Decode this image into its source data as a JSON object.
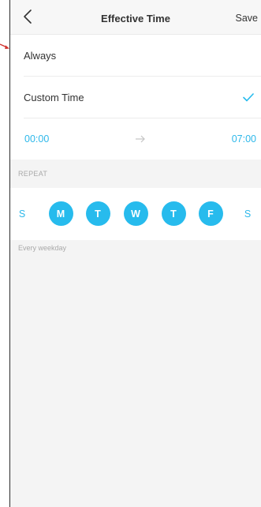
{
  "header": {
    "title": "Effective Time",
    "save_label": "Save"
  },
  "options": {
    "always_label": "Always",
    "custom_label": "Custom Time"
  },
  "time_range": {
    "start": "00:00",
    "end": "07:00"
  },
  "repeat": {
    "section_label": "REPEAT",
    "days": [
      {
        "label": "S",
        "selected": false
      },
      {
        "label": "M",
        "selected": true
      },
      {
        "label": "T",
        "selected": true
      },
      {
        "label": "W",
        "selected": true
      },
      {
        "label": "T",
        "selected": true
      },
      {
        "label": "F",
        "selected": true
      },
      {
        "label": "S",
        "selected": false
      }
    ],
    "summary": "Every weekday"
  },
  "colors": {
    "accent": "#27bbed",
    "text": "#333333",
    "muted": "#a9a9a9",
    "pointer": "#d0312d"
  }
}
